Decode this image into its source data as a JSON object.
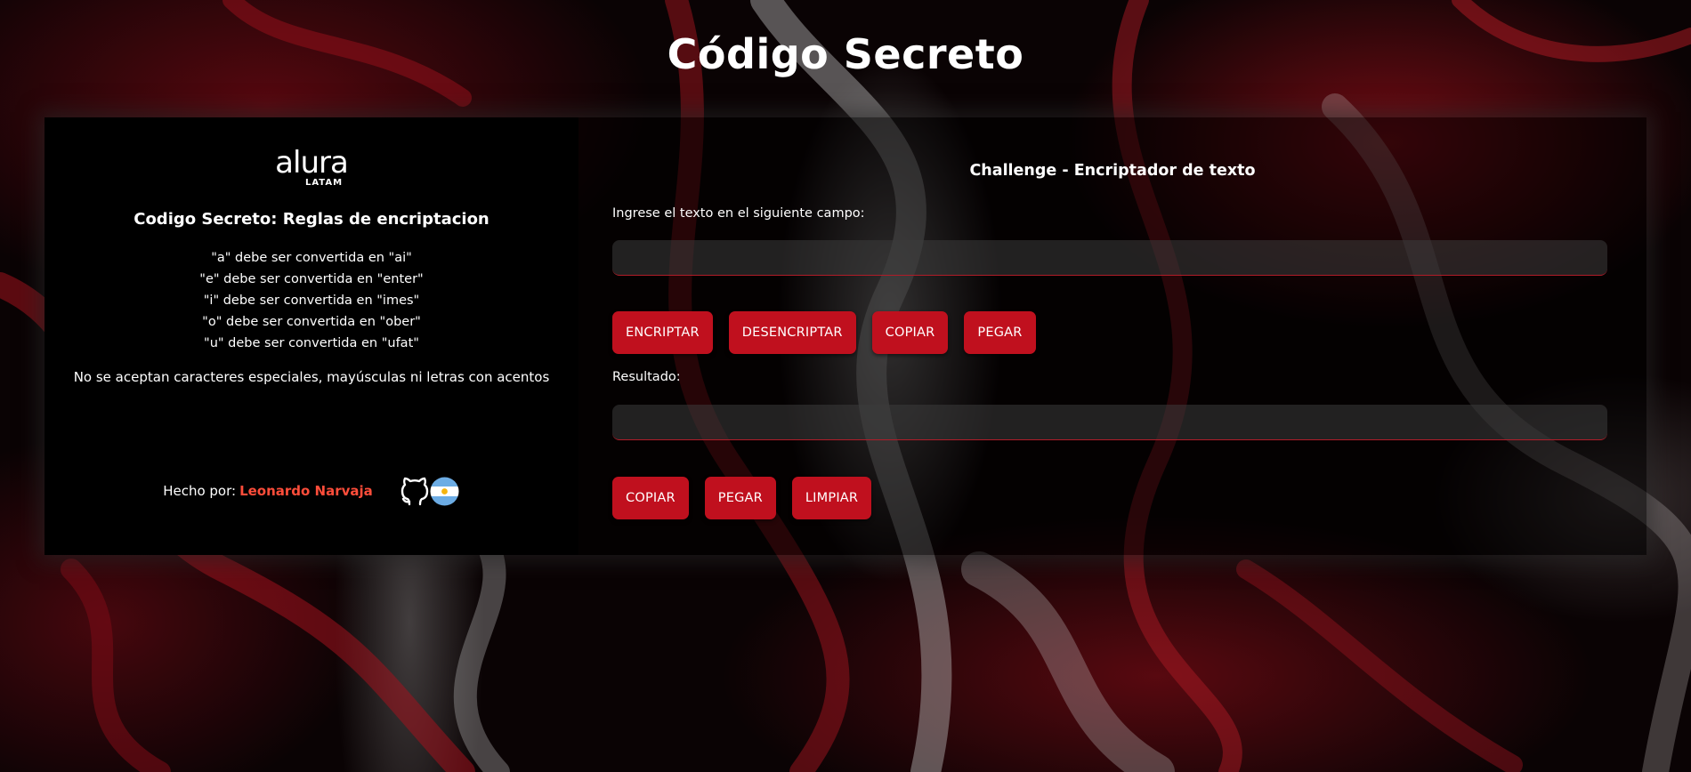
{
  "page": {
    "title": "Código Secreto"
  },
  "rules": {
    "logo_text": "alura",
    "logo_subtext": "LATAM",
    "title": "Codigo Secreto: Reglas de encriptacion",
    "items": [
      "\"a\" debe ser convertida en \"ai\"",
      "\"e\" debe ser convertida en \"enter\"",
      "\"i\" debe ser convertida en \"imes\"",
      "\"o\" debe ser convertida en \"ober\"",
      "\"u\" debe ser convertida en \"ufat\""
    ],
    "note": "No se aceptan caracteres especiales, mayúsculas ni letras con acentos",
    "credits_prefix": "Hecho por:",
    "author": "Leonardo Narvaja",
    "icons": [
      "github-icon",
      "argentina-flag-icon"
    ]
  },
  "main": {
    "title": "Challenge - Encriptador de texto",
    "input_label": "Ingrese el texto en el siguiente campo:",
    "input_value": "",
    "input_placeholder": "",
    "actions": {
      "encrypt": "ENCRIPTAR",
      "decrypt": "DESENCRIPTAR",
      "copy": "COPIAR",
      "paste": "PEGAR"
    },
    "result_label": "Resultado:",
    "result_value": "",
    "result_placeholder": "",
    "result_actions": {
      "copy": "COPIAR",
      "paste": "PEGAR",
      "clear": "LIMPIAR"
    }
  },
  "colors": {
    "accent": "#c0101e",
    "author_link": "#ff4d3a",
    "panel_left": "#000000"
  }
}
